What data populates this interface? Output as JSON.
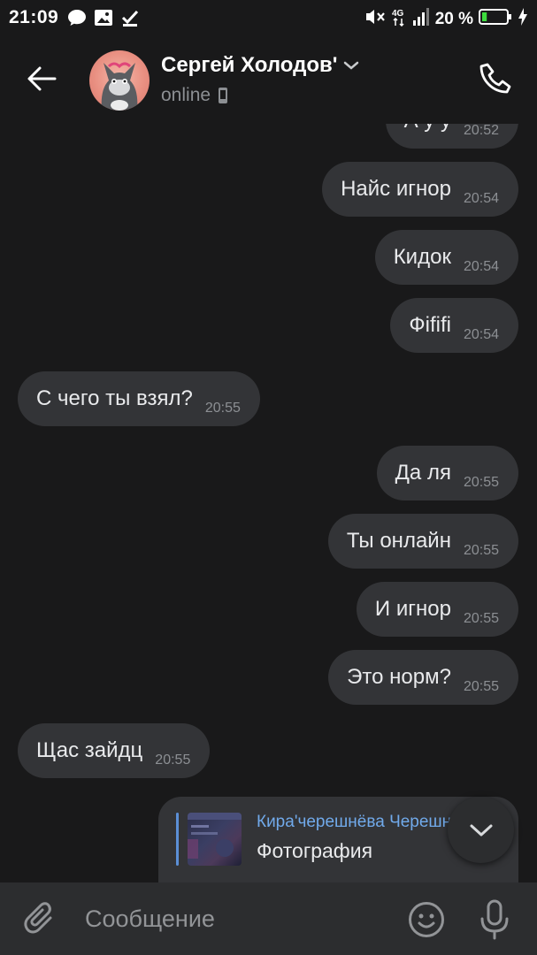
{
  "status_bar": {
    "time": "21:09",
    "battery_percent": "20 %",
    "battery_level": 0.2,
    "network": "4G",
    "icons": [
      "chat-bubble-icon",
      "image-icon",
      "checkmark-icon",
      "mute-icon",
      "4g-icon",
      "signal-icon",
      "battery-icon",
      "charging-icon"
    ]
  },
  "header": {
    "contact_name": "Сергей Холодов'",
    "status": "online",
    "icons": [
      "back-arrow-icon",
      "avatar",
      "chevron-down-icon",
      "mobile-icon",
      "phone-icon"
    ]
  },
  "messages": [
    {
      "direction": "out",
      "text": "А у у",
      "time": "20:52"
    },
    {
      "direction": "out",
      "text": "Найс игнор",
      "time": "20:54"
    },
    {
      "direction": "out",
      "text": "Кидок",
      "time": "20:54"
    },
    {
      "direction": "out",
      "text": "Фififi",
      "time": "20:54"
    },
    {
      "direction": "in",
      "text": "С чего ты взял?",
      "time": "20:55"
    },
    {
      "direction": "out",
      "text": "Да ля",
      "time": "20:55"
    },
    {
      "direction": "out",
      "text": "Ты онлайн",
      "time": "20:55"
    },
    {
      "direction": "out",
      "text": "И игнор",
      "time": "20:55"
    },
    {
      "direction": "out",
      "text": "Это норм?",
      "time": "20:55"
    },
    {
      "direction": "in",
      "text": "Щас зайдц",
      "time": "20:55"
    }
  ],
  "forwarded": {
    "author": "Кира'черешнёва Черешнёва",
    "label": "Фотография"
  },
  "composer": {
    "placeholder": "Сообщение"
  },
  "colors": {
    "background": "#19191a",
    "bubble": "#333437",
    "composer": "#2c2d2f",
    "accent_link": "#71aaeb",
    "muted": "#8c8f93"
  }
}
